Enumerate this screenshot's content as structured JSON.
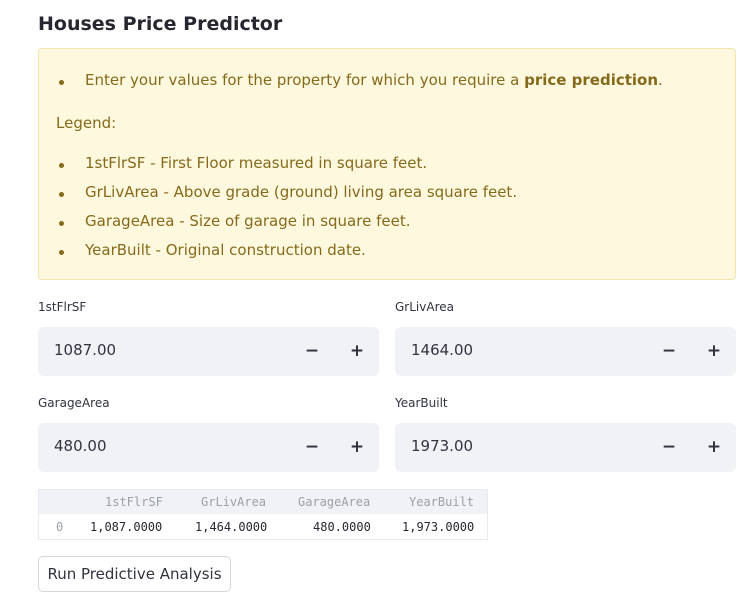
{
  "page": {
    "title": "Houses Price Predictor"
  },
  "info_box": {
    "intro_prefix": "Enter your values for the property for which you require a ",
    "intro_bold": "price prediction",
    "intro_suffix": ".",
    "legend_label": "Legend:",
    "legend_items": [
      "1stFlrSF - First Floor measured in square feet.",
      "GrLivArea - Above grade (ground) living area square feet.",
      "GarageArea - Size of garage in square feet.",
      "YearBuilt - Original construction date."
    ]
  },
  "inputs": [
    {
      "label": "1stFlrSF",
      "value": "1087.00",
      "minus": "−",
      "plus": "+"
    },
    {
      "label": "GrLivArea",
      "value": "1464.00",
      "minus": "−",
      "plus": "+"
    },
    {
      "label": "GarageArea",
      "value": "480.00",
      "minus": "−",
      "plus": "+"
    },
    {
      "label": "YearBuilt",
      "value": "1973.00",
      "minus": "−",
      "plus": "+"
    }
  ],
  "dataframe": {
    "columns": [
      "1stFlrSF",
      "GrLivArea",
      "GarageArea",
      "YearBuilt"
    ],
    "index": [
      "0"
    ],
    "rows": [
      [
        "1,087.0000",
        "1,464.0000",
        "480.0000",
        "1,973.0000"
      ]
    ]
  },
  "run_button": {
    "label": "Run Predictive Analysis"
  }
}
